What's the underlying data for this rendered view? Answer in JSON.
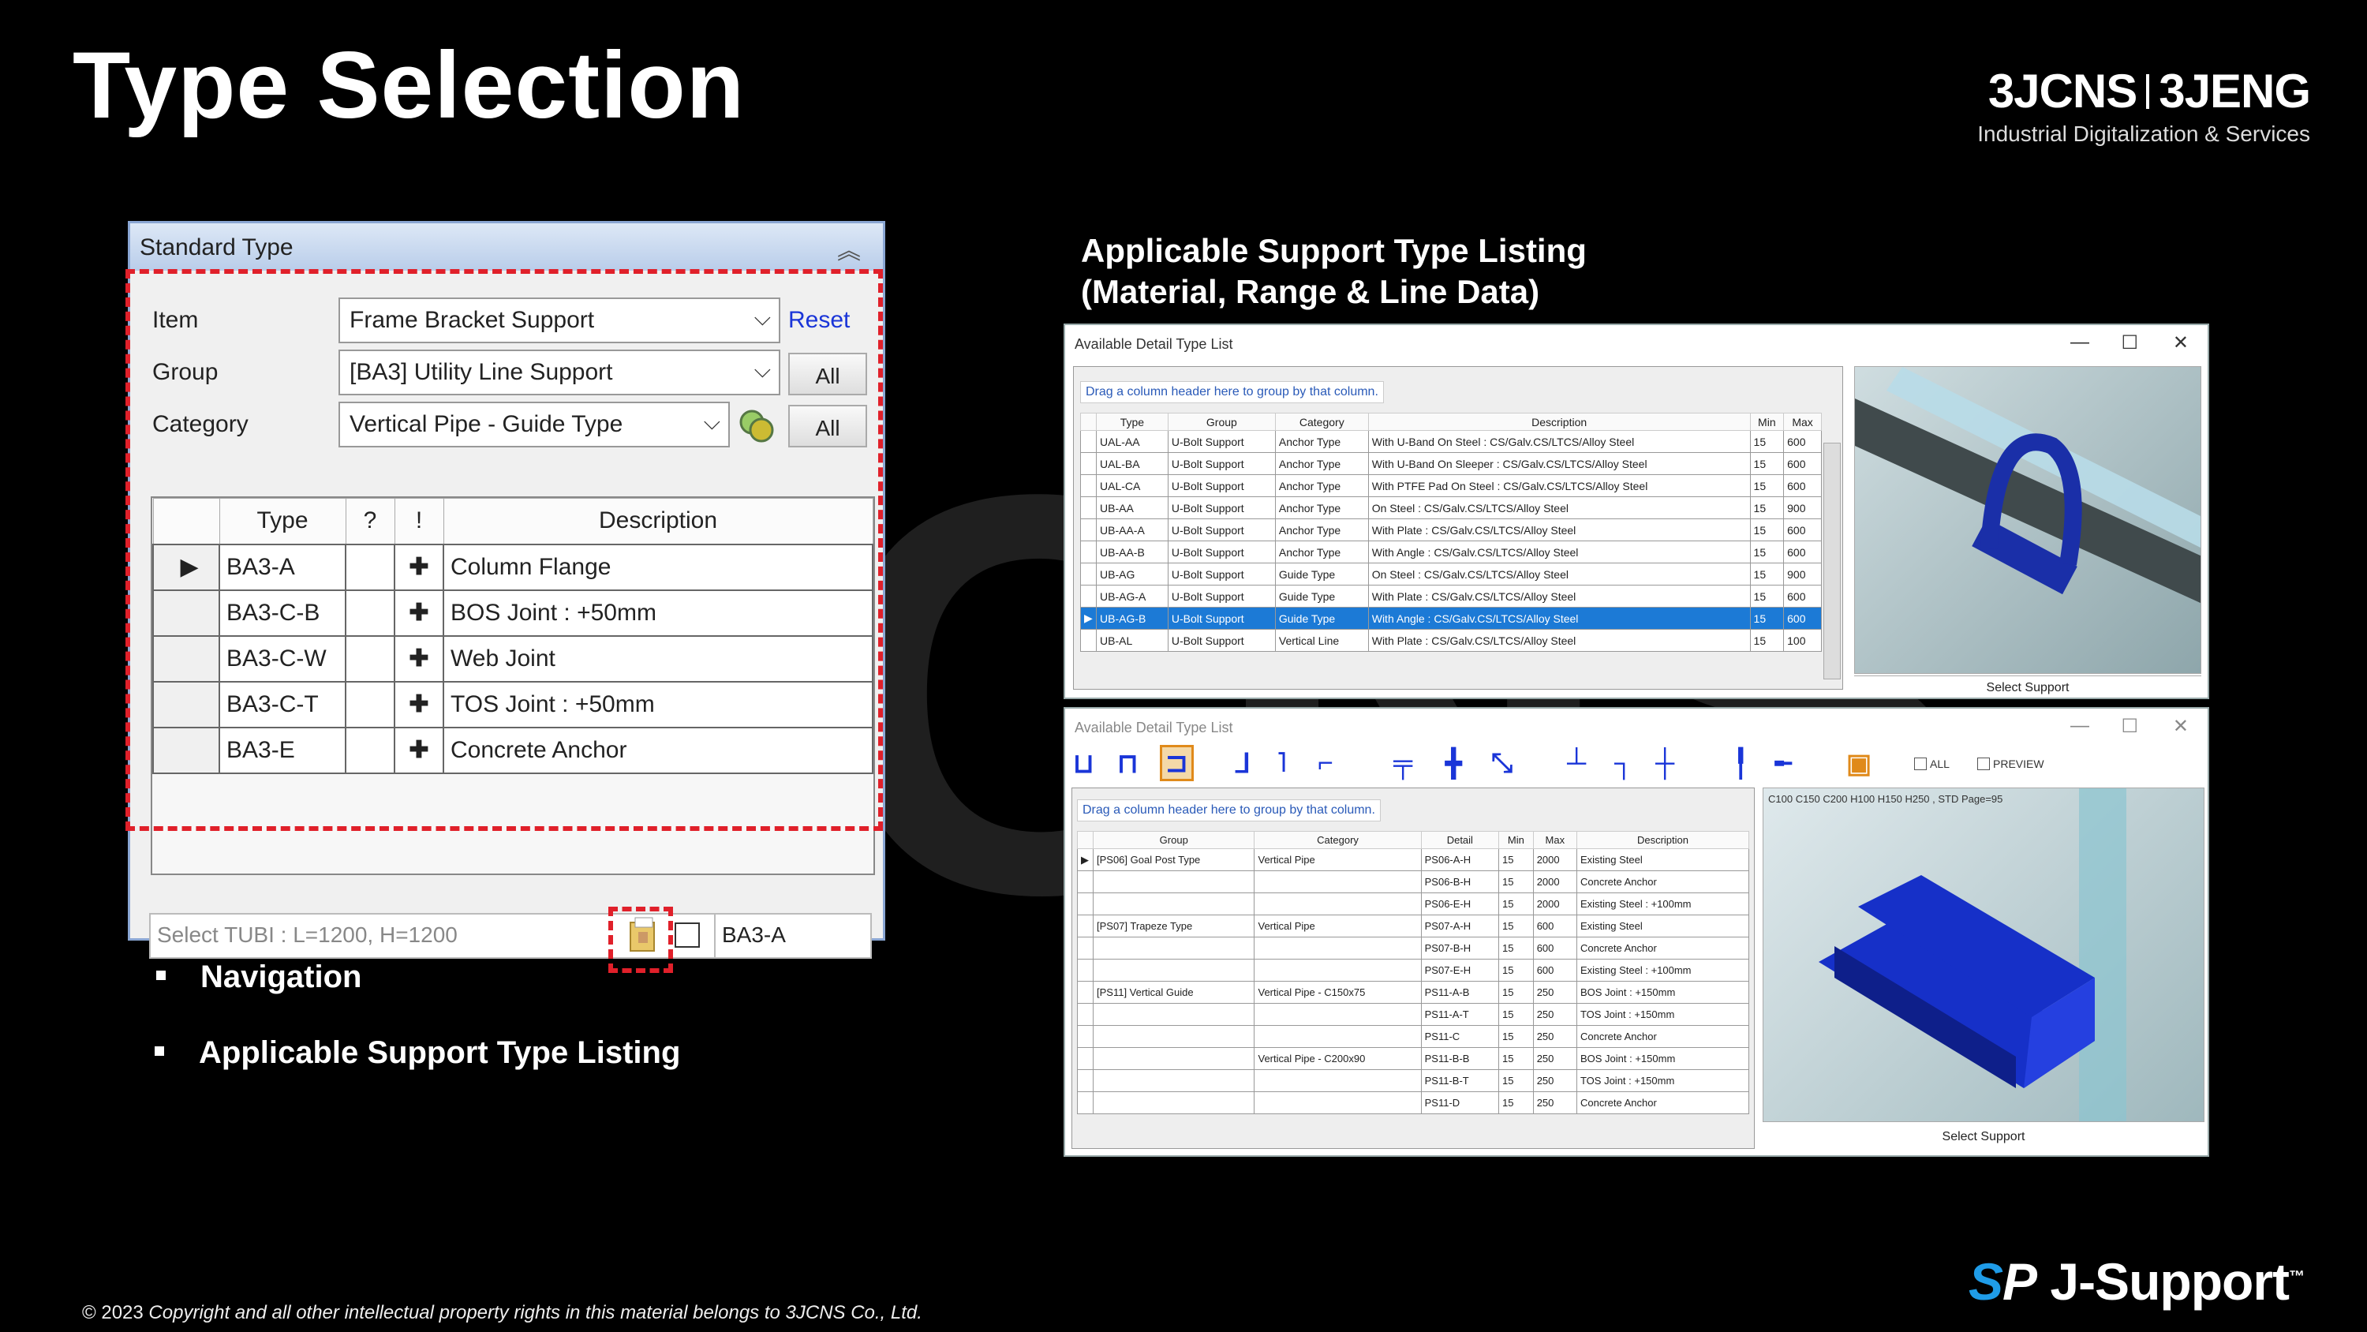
{
  "slide": {
    "title": "Type Selection",
    "brand": {
      "left": "3JCNS",
      "right": "3JENG",
      "tagline": "Industrial Digitalization & Services"
    },
    "watermark": "3JCNS",
    "right_title_line1": "Applicable Support Type Listing",
    "right_title_line2": "(Material, Range & Line Data)",
    "bullets": [
      "Navigation",
      "Applicable Support Type Listing"
    ],
    "copyright_year": "© 2023",
    "copyright_text": "Copyright and all other intellectual property rights in this material belongs to 3JCNS Co., Ltd.",
    "product_logo_sp": "SP",
    "product_logo_text": "J-Support",
    "product_logo_tm": "™"
  },
  "standard_panel": {
    "header": "Standard Type",
    "item_label": "Item",
    "item_value": "Frame Bracket Support",
    "reset_label": "Reset",
    "group_label": "Group",
    "group_value": "[BA3] Utility Line Support",
    "all_label": "All",
    "category_label": "Category",
    "category_value": "Vertical Pipe - Guide Type",
    "columns": [
      "Type",
      "?",
      "!",
      "Description"
    ],
    "rows": [
      {
        "type": "BA3-A",
        "desc": "Column Flange",
        "current": true
      },
      {
        "type": "BA3-C-B",
        "desc": "BOS Joint : +50mm",
        "current": false
      },
      {
        "type": "BA3-C-W",
        "desc": "Web Joint",
        "current": false
      },
      {
        "type": "BA3-C-T",
        "desc": "TOS Joint : +50mm",
        "current": false
      },
      {
        "type": "BA3-E",
        "desc": "Concrete Anchor",
        "current": false
      }
    ],
    "tubi_placeholder": "Select TUBI : L=1200, H=1200",
    "selected_type": "BA3-A"
  },
  "window1": {
    "title": "Available Detail Type List",
    "drag_hint": "Drag a column header here to group by that column.",
    "columns": [
      "Type",
      "Group",
      "Category",
      "Description",
      "Min",
      "Max"
    ],
    "rows": [
      [
        "UAL-AA",
        "U-Bolt Support",
        "Anchor Type",
        "With U-Band On Steel : CS/Galv.CS/LTCS/Alloy Steel",
        "15",
        "600"
      ],
      [
        "UAL-BA",
        "U-Bolt Support",
        "Anchor Type",
        "With U-Band On Sleeper : CS/Galv.CS/LTCS/Alloy Steel",
        "15",
        "600"
      ],
      [
        "UAL-CA",
        "U-Bolt Support",
        "Anchor Type",
        "With PTFE Pad On Steel : CS/Galv.CS/LTCS/Alloy Steel",
        "15",
        "600"
      ],
      [
        "UB-AA",
        "U-Bolt Support",
        "Anchor Type",
        "On Steel : CS/Galv.CS/LTCS/Alloy Steel",
        "15",
        "900"
      ],
      [
        "UB-AA-A",
        "U-Bolt Support",
        "Anchor Type",
        "With Plate : CS/Galv.CS/LTCS/Alloy Steel",
        "15",
        "600"
      ],
      [
        "UB-AA-B",
        "U-Bolt Support",
        "Anchor Type",
        "With Angle : CS/Galv.CS/LTCS/Alloy Steel",
        "15",
        "600"
      ],
      [
        "UB-AG",
        "U-Bolt Support",
        "Guide Type",
        "On Steel : CS/Galv.CS/LTCS/Alloy Steel",
        "15",
        "900"
      ],
      [
        "UB-AG-A",
        "U-Bolt Support",
        "Guide Type",
        "With Plate : CS/Galv.CS/LTCS/Alloy Steel",
        "15",
        "600"
      ],
      [
        "UB-AG-B",
        "U-Bolt Support",
        "Guide Type",
        "With Angle : CS/Galv.CS/LTCS/Alloy Steel",
        "15",
        "600"
      ],
      [
        "UB-AL",
        "U-Bolt Support",
        "Vertical Line",
        "With Plate : CS/Galv.CS/LTCS/Alloy Steel",
        "15",
        "100"
      ]
    ],
    "selected_row": 8,
    "view_caption": "Select Support"
  },
  "window2": {
    "title": "Available Detail Type List",
    "all_label": "ALL",
    "preview_label": "PREVIEW",
    "drag_hint": "Drag a column header here to group by that column.",
    "columns": [
      "Group",
      "Category",
      "Detail",
      "Min",
      "Max",
      "Description"
    ],
    "rows": [
      [
        "[PS06] Goal Post Type",
        "Vertical Pipe",
        "PS06-A-H",
        "15",
        "2000",
        "Existing Steel"
      ],
      [
        "",
        "",
        "PS06-B-H",
        "15",
        "2000",
        "Concrete Anchor"
      ],
      [
        "",
        "",
        "PS06-E-H",
        "15",
        "2000",
        "Existing Steel : +100mm"
      ],
      [
        "[PS07] Trapeze Type",
        "Vertical Pipe",
        "PS07-A-H",
        "15",
        "600",
        "Existing Steel"
      ],
      [
        "",
        "",
        "PS07-B-H",
        "15",
        "600",
        "Concrete Anchor"
      ],
      [
        "",
        "",
        "PS07-E-H",
        "15",
        "600",
        "Existing Steel : +100mm"
      ],
      [
        "[PS11] Vertical Guide",
        "Vertical Pipe - C150x75",
        "PS11-A-B",
        "15",
        "250",
        "BOS Joint : +150mm"
      ],
      [
        "",
        "",
        "PS11-A-T",
        "15",
        "250",
        "TOS Joint : +150mm"
      ],
      [
        "",
        "",
        "PS11-C",
        "15",
        "250",
        "Concrete Anchor"
      ],
      [
        "",
        "Vertical Pipe - C200x90",
        "PS11-B-B",
        "15",
        "250",
        "BOS Joint : +150mm"
      ],
      [
        "",
        "",
        "PS11-B-T",
        "15",
        "250",
        "TOS Joint : +150mm"
      ],
      [
        "",
        "",
        "PS11-D",
        "15",
        "250",
        "Concrete Anchor"
      ]
    ],
    "view_info": "C100 C150 C200 H100 H150 H250 , STD Page=95",
    "view_caption": "Select Support"
  },
  "colors": {
    "accent_blue": "#1a35d8",
    "red_dash": "#e0202a",
    "select_blue": "#1c7ad6",
    "logo_blue": "#1f9ce8"
  }
}
